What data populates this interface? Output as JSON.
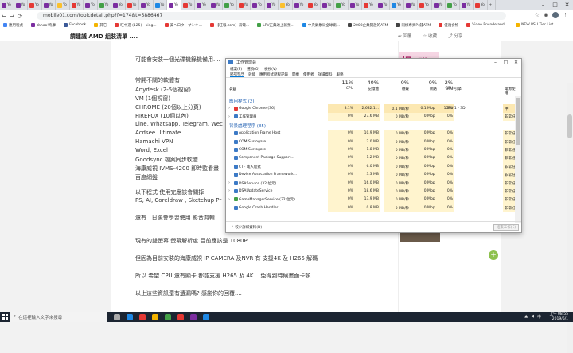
{
  "browser": {
    "tabs": [
      "Yo",
      "Yo",
      "Yo",
      "Yo",
      "Yo",
      "Yo",
      "Yo",
      "Yo",
      "Yo",
      "Yo",
      "Yo",
      "Yo",
      "Yo",
      "Yo",
      "Yo",
      "Yo",
      "Yo",
      "Yo",
      "Yo",
      "Yo",
      "Yo",
      "Yo",
      "Yo",
      "Yo",
      "Yo",
      "Yo",
      "Yo",
      "Yo",
      "Yo",
      "Yo",
      "Yo",
      "Yo",
      "Yo",
      "Yo",
      "Yo"
    ],
    "tab_colors": [
      "#7b2ea0",
      "#7b2ea0",
      "#e53935",
      "#7b2ea0",
      "#fbc02d",
      "#e53935",
      "#7b2ea0",
      "#43a047",
      "#7b2ea0",
      "#e53935",
      "#7b2ea0",
      "#1e88e5",
      "#7b2ea0",
      "#e53935",
      "#7b2ea0",
      "#7b2ea0",
      "#43a047",
      "#e53935",
      "#7b2ea0",
      "#7b2ea0",
      "#fbc02d",
      "#7b2ea0",
      "#e53935",
      "#7b2ea0",
      "#43a047",
      "#7b2ea0",
      "#e53935",
      "#7b2ea0",
      "#1e88e5",
      "#7b2ea0",
      "#e53935",
      "#7b2ea0",
      "#43a047",
      "#7b2ea0",
      "#e53935"
    ],
    "active_tab": 12,
    "new_tab": "+",
    "url": "mobile01.com/topicdetail.php?f=174&t=5886467",
    "bookmarks": [
      {
        "label": "應用程式",
        "color": "#4285f4"
      },
      {
        "label": "Yahoo!奇摩",
        "color": "#7b2ea0"
      },
      {
        "label": "Facebook",
        "color": "#3b5998"
      },
      {
        "label": "其它",
        "color": "#f4b400"
      },
      {
        "label": "旺中選 (125) - king...",
        "color": "#e53935"
      },
      {
        "label": "美ヘロウ・サンキ...",
        "color": "#e53935"
      },
      {
        "label": "【旺報.com】海電...",
        "color": "#e53935"
      },
      {
        "label": "LPV正典達上新預...",
        "color": "#43a047"
      },
      {
        "label": "中央氣象局全球衛...",
        "color": "#1e88e5"
      },
      {
        "label": "2008企業開放的ATM",
        "color": "#444"
      },
      {
        "label": "同樣專頁Ps錢ATM",
        "color": "#444"
      },
      {
        "label": "優雅食物",
        "color": "#e53935"
      },
      {
        "label": "Video Encode and...",
        "color": "#e53935"
      },
      {
        "label": "NEW PSU Tier List...",
        "color": "#f4b400"
      }
    ]
  },
  "site": {
    "title": "請建議 AMD 組裝清單 ....",
    "reply": "回覆",
    "collect": "收藏",
    "share": "分享"
  },
  "post": {
    "lines": [
      "可能會安裝一個光碟機錄機備用....",
      "常開不關的軟體有",
      "Anydesk (2-5個視窗)",
      "VM (1個視窗)",
      "CHROME (20個以上分頁)",
      "FIREFOX (10個以內)",
      "Line, Whatsapp, Telegram, Wec",
      "Acdsee Ultimate",
      "Hamachi VPN",
      "Word, Excel",
      "Goodsync 檔案同步軟體",
      "海康威視 IVMS-4200 即時監看畫",
      "百度網盤",
      "以下程式 使用完應該會關掉",
      "PS, AI, Coreldraw , Sketchup Pr",
      "還有...日後會學習使用 影音剪輯...",
      "現有的雙螢幕 螢幕解析度 目前應該是 1080P....",
      "但因為目前安裝的海康威視 IP CAMERA 及NVR 有 支援4K 及 H265 解碼",
      "所以 希望 CPU 還有顯卡 都能支援 H265 及 4K....免得到時候畫面卡頓....",
      "以上這些資訊還有遺漏嗎? 感謝你的回覆...."
    ]
  },
  "sidebar": {
    "ad_text": [
      "相",
      "購"
    ],
    "plus": "+"
  },
  "taskmgr": {
    "title": "工作管理員",
    "menu": [
      "檔案(F)",
      "選項(O)",
      "檢視(V)"
    ],
    "tabs": [
      "處理程序",
      "效能",
      "應用程式歷程記錄",
      "開機",
      "使用者",
      "詳細資料",
      "服務"
    ],
    "columns": [
      {
        "label": "名稱",
        "pct": ""
      },
      {
        "label": "CPU",
        "pct": "11%"
      },
      {
        "label": "記憶體",
        "pct": "40%"
      },
      {
        "label": "磁碟",
        "pct": "0%"
      },
      {
        "label": "網路",
        "pct": "0%"
      },
      {
        "label": "GPU",
        "pct": "2%"
      },
      {
        "label": "GPU 引擎",
        "pct": ""
      },
      {
        "label": "電源使用",
        "pct": ""
      }
    ],
    "group_apps": "應用程式 (2)",
    "group_bg": "背景處理程序 (85)",
    "rows": [
      {
        "name": "Google Chrome (36)",
        "cpu": "8.1%",
        "mem": "2,682.1...",
        "disk": "0.1 MB/秒",
        "net": "0.1 Mbps",
        "gpu": "1.3%",
        "eng": "GPU 1 - 3D",
        "pow": "中",
        "hl": "#fce8b2",
        "ic": "#e53935",
        "exp": true
      },
      {
        "name": "工作管理員",
        "cpu": "0%",
        "mem": "27.6 MB",
        "disk": "0 MB/秒",
        "net": "0 Mbps",
        "gpu": "0%",
        "eng": "",
        "pow": "非常低",
        "hl": "#fff4ce",
        "ic": "#3c7ac6",
        "exp": true
      },
      {
        "name": "Application Frame Host",
        "cpu": "0%",
        "mem": "10.9 MB",
        "disk": "0 MB/秒",
        "net": "0 Mbps",
        "gpu": "0%",
        "eng": "",
        "pow": "非常低",
        "hl": "#fff4ce",
        "ic": "#3c7ac6",
        "exp": false
      },
      {
        "name": "COM Surrogate",
        "cpu": "0%",
        "mem": "2.0 MB",
        "disk": "0 MB/秒",
        "net": "0 Mbps",
        "gpu": "0%",
        "eng": "",
        "pow": "非常低",
        "hl": "#fff4ce",
        "ic": "#3c7ac6",
        "exp": false
      },
      {
        "name": "COM Surrogate",
        "cpu": "0%",
        "mem": "1.8 MB",
        "disk": "0 MB/秒",
        "net": "0 Mbps",
        "gpu": "0%",
        "eng": "",
        "pow": "非常低",
        "hl": "#fff4ce",
        "ic": "#3c7ac6",
        "exp": false
      },
      {
        "name": "Component Package Support...",
        "cpu": "0%",
        "mem": "1.2 MB",
        "disk": "0 MB/秒",
        "net": "0 Mbps",
        "gpu": "0%",
        "eng": "",
        "pow": "非常低",
        "hl": "#fff4ce",
        "ic": "#3c7ac6",
        "exp": false
      },
      {
        "name": "CTF 載入程式",
        "cpu": "0%",
        "mem": "6.0 MB",
        "disk": "0 MB/秒",
        "net": "0 Mbps",
        "gpu": "0%",
        "eng": "",
        "pow": "非常低",
        "hl": "#fff4ce",
        "ic": "#3c7ac6",
        "exp": false
      },
      {
        "name": "Device Association Framework...",
        "cpu": "0%",
        "mem": "3.3 MB",
        "disk": "0 MB/秒",
        "net": "0 Mbps",
        "gpu": "0%",
        "eng": "",
        "pow": "非常低",
        "hl": "#fff4ce",
        "ic": "#3c7ac6",
        "exp": false
      },
      {
        "name": "DSAService (32 位元)",
        "cpu": "0%",
        "mem": "16.0 MB",
        "disk": "0 MB/秒",
        "net": "0 Mbps",
        "gpu": "0%",
        "eng": "",
        "pow": "非常低",
        "hl": "#fff4ce",
        "ic": "#3c7ac6",
        "exp": true
      },
      {
        "name": "DSAUpdateService",
        "cpu": "0%",
        "mem": "18.6 MB",
        "disk": "0 MB/秒",
        "net": "0 Mbps",
        "gpu": "0%",
        "eng": "",
        "pow": "非常低",
        "hl": "#fff4ce",
        "ic": "#3c7ac6",
        "exp": true
      },
      {
        "name": "GameManagerService (32 位元)",
        "cpu": "0%",
        "mem": "13.9 MB",
        "disk": "0 MB/秒",
        "net": "0 Mbps",
        "gpu": "0%",
        "eng": "",
        "pow": "非常低",
        "hl": "#fff4ce",
        "ic": "#43a047",
        "exp": true
      },
      {
        "name": "Google Crash Handler",
        "cpu": "0%",
        "mem": "0.8 MB",
        "disk": "0 MB/秒",
        "net": "0 Mbps",
        "gpu": "0%",
        "eng": "",
        "pow": "非常低",
        "hl": "#fff4ce",
        "ic": "#3c7ac6",
        "exp": false
      }
    ],
    "fewer_details": "較少詳細資料(D)",
    "end_task": "結束工作(E)"
  },
  "taskbar": {
    "search_placeholder": "在這裡輸入文字來搜尋",
    "time": "上午 08:55",
    "date": "2019/6/1",
    "icons": [
      "#aaaaaa",
      "#1e88e5",
      "#e53935",
      "#f4b400",
      "#43a047",
      "#e53935",
      "#7b2ea0",
      "#1e88e5"
    ]
  }
}
